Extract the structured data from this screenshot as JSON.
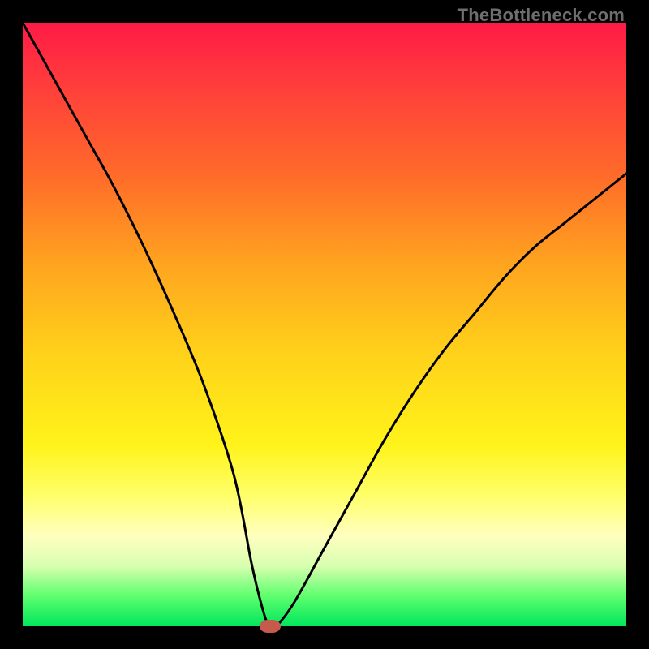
{
  "watermark": "TheBottleneck.com",
  "colors": {
    "frame": "#000000",
    "gradient_top": "#ff1a46",
    "gradient_bottom": "#00e65c",
    "curve": "#000000",
    "marker": "#c65a4d"
  },
  "chart_data": {
    "type": "line",
    "title": "",
    "xlabel": "",
    "ylabel": "",
    "xlim": [
      0,
      100
    ],
    "ylim": [
      0,
      100
    ],
    "x": [
      0,
      5,
      10,
      15,
      20,
      25,
      30,
      35,
      38,
      40,
      41,
      42,
      45,
      50,
      55,
      60,
      65,
      70,
      75,
      80,
      85,
      90,
      95,
      100
    ],
    "values": [
      100,
      91,
      82,
      73,
      63,
      52,
      40,
      25,
      10,
      2,
      0,
      0,
      4,
      13,
      22,
      31,
      39,
      46,
      52,
      58,
      63,
      67,
      71,
      75
    ],
    "minimum": {
      "x": 41,
      "y": 0
    },
    "marker": {
      "x": 41,
      "y": 0
    }
  }
}
